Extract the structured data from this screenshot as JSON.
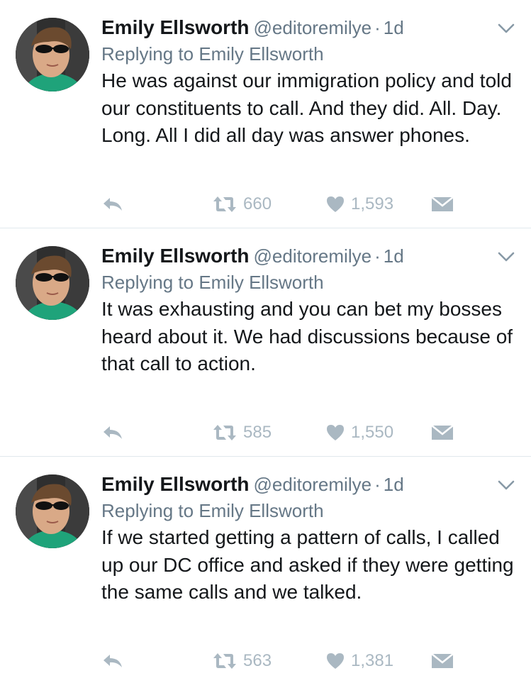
{
  "tweets": [
    {
      "author_name": "Emily Ellsworth",
      "handle": "@editoremilye",
      "separator": "·",
      "time": "1d",
      "replying_prefix": "Replying to",
      "replying_to": "Emily Ellsworth",
      "text": "He was against our immigration policy and told our constituents to call. And they did. All. Day. Long. All I did all day was answer phones.",
      "retweets": "660",
      "likes": "1,593"
    },
    {
      "author_name": "Emily Ellsworth",
      "handle": "@editoremilye",
      "separator": "·",
      "time": "1d",
      "replying_prefix": "Replying to",
      "replying_to": "Emily Ellsworth",
      "text": "It was exhausting and you can bet my bosses heard about it. We had discussions because of that call to action.",
      "retweets": "585",
      "likes": "1,550"
    },
    {
      "author_name": "Emily Ellsworth",
      "handle": "@editoremilye",
      "separator": "·",
      "time": "1d",
      "replying_prefix": "Replying to",
      "replying_to": "Emily Ellsworth",
      "text": "If we started getting a pattern of calls, I called up our DC office and asked if they were getting the same calls and we talked.",
      "retweets": "563",
      "likes": "1,381"
    }
  ],
  "icons": {
    "reply": "reply-icon",
    "retweet": "retweet-icon",
    "like": "heart-icon",
    "dm": "envelope-icon",
    "menu": "chevron-down-icon"
  },
  "colors": {
    "text": "#14171a",
    "secondary": "#657786",
    "action": "#aab8c2",
    "divider": "#e1e8ed"
  }
}
